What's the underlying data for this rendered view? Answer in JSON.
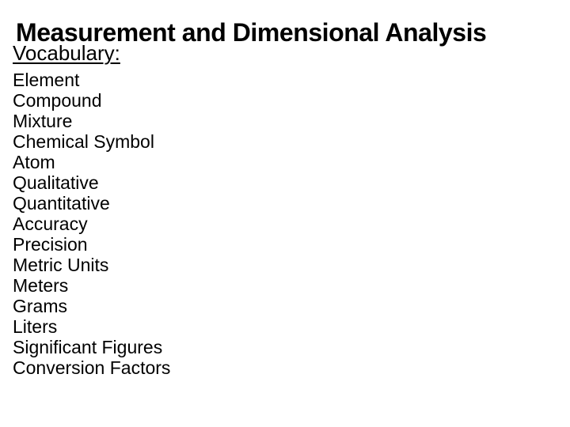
{
  "slide": {
    "title": "Measurement and Dimensional Analysis",
    "vocabulary_heading": "Vocabulary:",
    "vocabulary_terms": [
      "Element",
      "Compound",
      "Mixture",
      "Chemical Symbol",
      "Atom",
      "Qualitative",
      "Quantitative",
      "Accuracy",
      "Precision",
      "Metric Units",
      "Meters",
      "Grams",
      "Liters",
      "Significant Figures",
      "Conversion Factors"
    ],
    "colors": {
      "background": "#ffffff",
      "text": "#000000"
    }
  }
}
